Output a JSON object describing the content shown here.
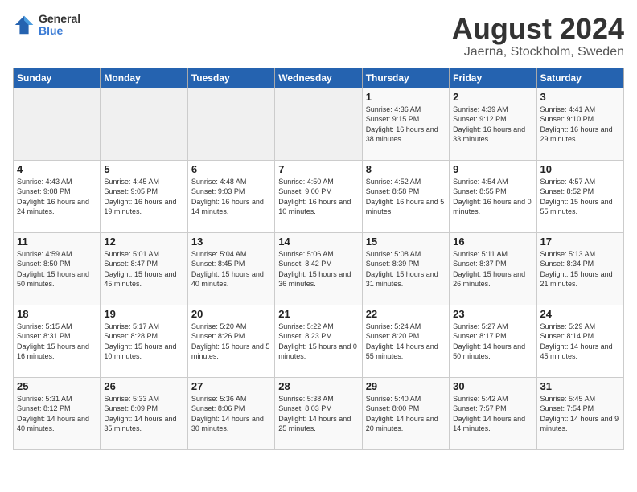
{
  "header": {
    "logo_general": "General",
    "logo_blue": "Blue",
    "month": "August 2024",
    "location": "Jaerna, Stockholm, Sweden"
  },
  "weekdays": [
    "Sunday",
    "Monday",
    "Tuesday",
    "Wednesday",
    "Thursday",
    "Friday",
    "Saturday"
  ],
  "weeks": [
    [
      {
        "day": "",
        "info": ""
      },
      {
        "day": "",
        "info": ""
      },
      {
        "day": "",
        "info": ""
      },
      {
        "day": "",
        "info": ""
      },
      {
        "day": "1",
        "info": "Sunrise: 4:36 AM\nSunset: 9:15 PM\nDaylight: 16 hours\nand 38 minutes."
      },
      {
        "day": "2",
        "info": "Sunrise: 4:39 AM\nSunset: 9:12 PM\nDaylight: 16 hours\nand 33 minutes."
      },
      {
        "day": "3",
        "info": "Sunrise: 4:41 AM\nSunset: 9:10 PM\nDaylight: 16 hours\nand 29 minutes."
      }
    ],
    [
      {
        "day": "4",
        "info": "Sunrise: 4:43 AM\nSunset: 9:08 PM\nDaylight: 16 hours\nand 24 minutes."
      },
      {
        "day": "5",
        "info": "Sunrise: 4:45 AM\nSunset: 9:05 PM\nDaylight: 16 hours\nand 19 minutes."
      },
      {
        "day": "6",
        "info": "Sunrise: 4:48 AM\nSunset: 9:03 PM\nDaylight: 16 hours\nand 14 minutes."
      },
      {
        "day": "7",
        "info": "Sunrise: 4:50 AM\nSunset: 9:00 PM\nDaylight: 16 hours\nand 10 minutes."
      },
      {
        "day": "8",
        "info": "Sunrise: 4:52 AM\nSunset: 8:58 PM\nDaylight: 16 hours\nand 5 minutes."
      },
      {
        "day": "9",
        "info": "Sunrise: 4:54 AM\nSunset: 8:55 PM\nDaylight: 16 hours\nand 0 minutes."
      },
      {
        "day": "10",
        "info": "Sunrise: 4:57 AM\nSunset: 8:52 PM\nDaylight: 15 hours\nand 55 minutes."
      }
    ],
    [
      {
        "day": "11",
        "info": "Sunrise: 4:59 AM\nSunset: 8:50 PM\nDaylight: 15 hours\nand 50 minutes."
      },
      {
        "day": "12",
        "info": "Sunrise: 5:01 AM\nSunset: 8:47 PM\nDaylight: 15 hours\nand 45 minutes."
      },
      {
        "day": "13",
        "info": "Sunrise: 5:04 AM\nSunset: 8:45 PM\nDaylight: 15 hours\nand 40 minutes."
      },
      {
        "day": "14",
        "info": "Sunrise: 5:06 AM\nSunset: 8:42 PM\nDaylight: 15 hours\nand 36 minutes."
      },
      {
        "day": "15",
        "info": "Sunrise: 5:08 AM\nSunset: 8:39 PM\nDaylight: 15 hours\nand 31 minutes."
      },
      {
        "day": "16",
        "info": "Sunrise: 5:11 AM\nSunset: 8:37 PM\nDaylight: 15 hours\nand 26 minutes."
      },
      {
        "day": "17",
        "info": "Sunrise: 5:13 AM\nSunset: 8:34 PM\nDaylight: 15 hours\nand 21 minutes."
      }
    ],
    [
      {
        "day": "18",
        "info": "Sunrise: 5:15 AM\nSunset: 8:31 PM\nDaylight: 15 hours\nand 16 minutes."
      },
      {
        "day": "19",
        "info": "Sunrise: 5:17 AM\nSunset: 8:28 PM\nDaylight: 15 hours\nand 10 minutes."
      },
      {
        "day": "20",
        "info": "Sunrise: 5:20 AM\nSunset: 8:26 PM\nDaylight: 15 hours\nand 5 minutes."
      },
      {
        "day": "21",
        "info": "Sunrise: 5:22 AM\nSunset: 8:23 PM\nDaylight: 15 hours\nand 0 minutes."
      },
      {
        "day": "22",
        "info": "Sunrise: 5:24 AM\nSunset: 8:20 PM\nDaylight: 14 hours\nand 55 minutes."
      },
      {
        "day": "23",
        "info": "Sunrise: 5:27 AM\nSunset: 8:17 PM\nDaylight: 14 hours\nand 50 minutes."
      },
      {
        "day": "24",
        "info": "Sunrise: 5:29 AM\nSunset: 8:14 PM\nDaylight: 14 hours\nand 45 minutes."
      }
    ],
    [
      {
        "day": "25",
        "info": "Sunrise: 5:31 AM\nSunset: 8:12 PM\nDaylight: 14 hours\nand 40 minutes."
      },
      {
        "day": "26",
        "info": "Sunrise: 5:33 AM\nSunset: 8:09 PM\nDaylight: 14 hours\nand 35 minutes."
      },
      {
        "day": "27",
        "info": "Sunrise: 5:36 AM\nSunset: 8:06 PM\nDaylight: 14 hours\nand 30 minutes."
      },
      {
        "day": "28",
        "info": "Sunrise: 5:38 AM\nSunset: 8:03 PM\nDaylight: 14 hours\nand 25 minutes."
      },
      {
        "day": "29",
        "info": "Sunrise: 5:40 AM\nSunset: 8:00 PM\nDaylight: 14 hours\nand 20 minutes."
      },
      {
        "day": "30",
        "info": "Sunrise: 5:42 AM\nSunset: 7:57 PM\nDaylight: 14 hours\nand 14 minutes."
      },
      {
        "day": "31",
        "info": "Sunrise: 5:45 AM\nSunset: 7:54 PM\nDaylight: 14 hours\nand 9 minutes."
      }
    ]
  ]
}
